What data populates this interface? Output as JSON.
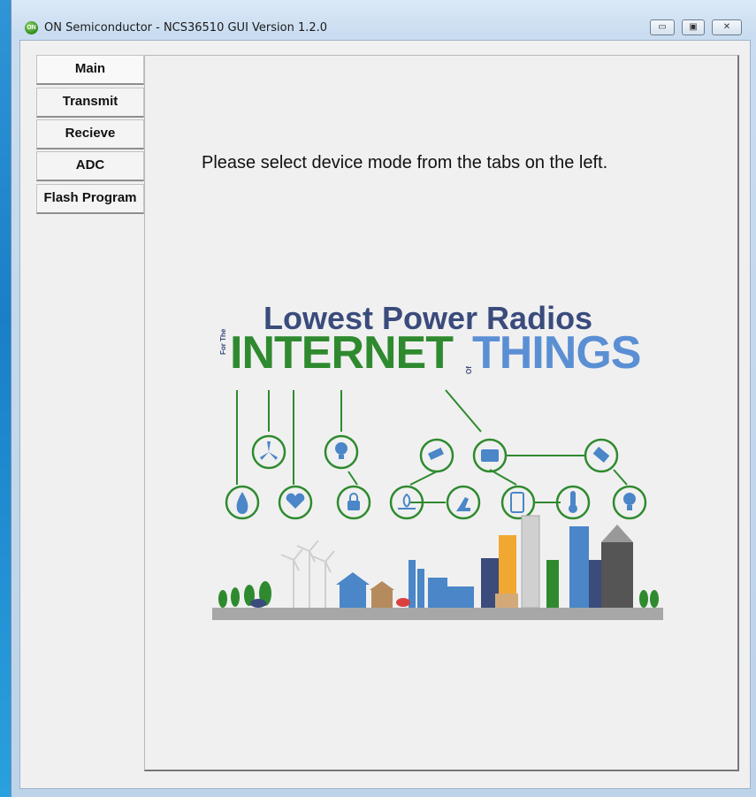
{
  "window": {
    "title": "ON Semiconductor - NCS36510 GUI Version 1.2.0",
    "icon_text": "ON",
    "minimize_glyph": "▭",
    "maximize_glyph": "▣",
    "close_glyph": "✕"
  },
  "tabs": [
    {
      "label": "Main",
      "active": true
    },
    {
      "label": "Transmit",
      "active": false
    },
    {
      "label": "Recieve",
      "active": false
    },
    {
      "label": "ADC",
      "active": false
    },
    {
      "label": "Flash Program",
      "active": false
    }
  ],
  "main": {
    "message": "Please select device mode from the tabs on the left.",
    "banner": {
      "title": "Lowest Power Radios",
      "for_the": "For The",
      "word1": "INTERNET",
      "of": "Of",
      "word2": "THINGS"
    }
  },
  "colors": {
    "green": "#2f8a2f",
    "blue": "#5b8fd4",
    "navy": "#3a4b7c"
  },
  "icons": [
    "water-drop-icon",
    "wind-turbine-icon",
    "heart-monitor-icon",
    "lightbulb-icon",
    "padlock-icon",
    "security-camera-icon",
    "gauge-meter-icon",
    "robot-arm-icon",
    "cloud-server-icon",
    "smartphone-icon",
    "thermometer-icon",
    "satellite-icon",
    "smart-bulb-icon"
  ]
}
